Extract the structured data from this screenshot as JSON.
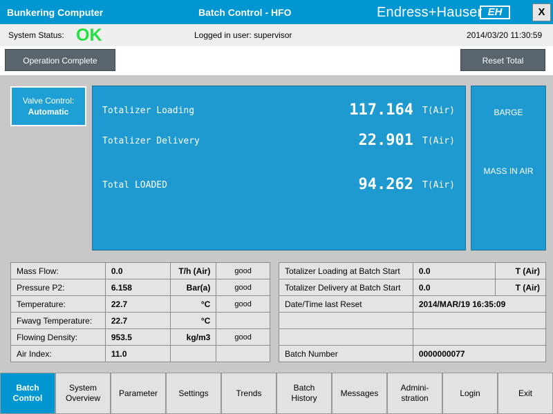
{
  "titlebar": {
    "app_title": "Bunkering Computer",
    "screen_title": "Batch Control - HFO",
    "brand": "Endress+Hauser",
    "brand_logo": "EH",
    "close_label": "X"
  },
  "status": {
    "label": "System Status:",
    "value": "OK",
    "logged_user": "Logged in user: supervisor",
    "datetime": "2014/03/20 11:30:59"
  },
  "actions": {
    "operation_complete": "Operation Complete",
    "reset_total": "Reset Total"
  },
  "valve": {
    "label": "Valve Control:",
    "mode": "Automatic"
  },
  "totalizers": [
    {
      "label": "Totalizer Loading",
      "value": "117.164",
      "unit": "T(Air)"
    },
    {
      "label": "Totalizer Delivery",
      "value": "22.901",
      "unit": "T(Air)"
    },
    {
      "label": "Total LOADED",
      "value": "94.262",
      "unit": "T(Air)"
    }
  ],
  "side": {
    "barge": "BARGE",
    "mass": "MASS IN AIR"
  },
  "measurements": [
    {
      "name": "Mass Flow:",
      "value": "0.0",
      "unit": "T/h (Air)",
      "quality": "good"
    },
    {
      "name": "Pressure P2:",
      "value": "6.158",
      "unit": "Bar(a)",
      "quality": "good"
    },
    {
      "name": "Temperature:",
      "value": "22.7",
      "unit": "°C",
      "quality": "good"
    },
    {
      "name": "Fwavg Temperature:",
      "value": "22.7",
      "unit": "°C",
      "quality": ""
    },
    {
      "name": "Flowing Density:",
      "value": "953.5",
      "unit": "kg/m3",
      "quality": "good"
    },
    {
      "name": "Air Index:",
      "value": "11.0",
      "unit": "",
      "quality": ""
    }
  ],
  "batch_info": [
    {
      "name": "Totalizer Loading at Batch Start",
      "value": "0.0",
      "unit": "T (Air)"
    },
    {
      "name": "Totalizer Delivery at Batch Start",
      "value": "0.0",
      "unit": "T (Air)"
    },
    {
      "name": "Date/Time last Reset",
      "value": "2014/MAR/19 16:35:09",
      "unit": ""
    },
    {
      "name": "",
      "value": "",
      "unit": ""
    },
    {
      "name": "",
      "value": "",
      "unit": ""
    },
    {
      "name": "Batch Number",
      "value": "0000000077",
      "unit": ""
    }
  ],
  "nav": [
    {
      "line1": "Batch",
      "line2": "Control"
    },
    {
      "line1": "System",
      "line2": "Overview"
    },
    {
      "line1": "Parameter",
      "line2": ""
    },
    {
      "line1": "Settings",
      "line2": ""
    },
    {
      "line1": "Trends",
      "line2": ""
    },
    {
      "line1": "Batch",
      "line2": "History"
    },
    {
      "line1": "Messages",
      "line2": ""
    },
    {
      "line1": "Admini-",
      "line2": "stration"
    },
    {
      "line1": "Login",
      "line2": ""
    },
    {
      "line1": "Exit",
      "line2": ""
    }
  ]
}
